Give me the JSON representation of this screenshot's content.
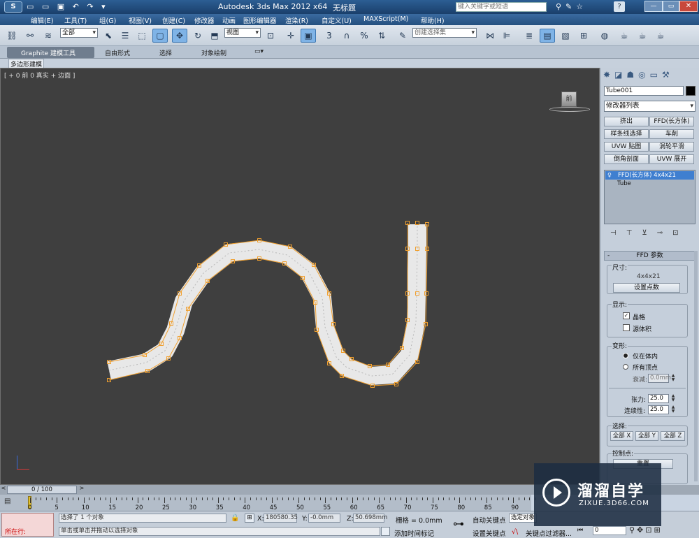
{
  "app": {
    "title": "Autodesk 3ds Max  2012 x64",
    "doc": "无标题",
    "search_placeholder": "键入关键字或短语"
  },
  "menu": [
    "编辑(E)",
    "工具(T)",
    "组(G)",
    "视图(V)",
    "创建(C)",
    "修改器",
    "动画",
    "图形编辑器",
    "渲染(R)",
    "自定义(U)",
    "MAXScript(M)",
    "帮助(H)"
  ],
  "toolbar": {
    "selection_filter": "全部",
    "ref_coord": "视图",
    "named_selection": "创建选择集",
    "snap_labels": [
      "3",
      "%",
      "n"
    ]
  },
  "ribbon": {
    "tabs": [
      "Graphite 建模工具",
      "自由形式",
      "选择",
      "对象绘制"
    ],
    "sub": "多边形建模"
  },
  "viewport": {
    "label": "[ + 0 前 0 真实 + 边面 ]",
    "viewcube_face": "前"
  },
  "panel": {
    "object_name": "Tube001",
    "modifier_list": "修改器列表",
    "mod_buttons": [
      "挤出",
      "FFD(长方体)",
      "样条线选择",
      "车削",
      "UVW 贴图",
      "涡轮平滑",
      "倒角剖面",
      "UVW 展开"
    ],
    "stack": [
      "FFD(长方体) 4x4x21",
      "Tube"
    ],
    "rollout_title": "FFD 参数",
    "dims_label": "尺寸:",
    "dims_value": "4x4x21",
    "set_points": "设置点数",
    "display_label": "显示:",
    "lattice": "晶格",
    "source_volume": "源体积",
    "deform_label": "变形:",
    "only_in_volume": "仅在体内",
    "all_vertices": "所有顶点",
    "falloff_label": "衰减:",
    "falloff_value": "0.0mm",
    "tension_label": "张力:",
    "tension_value": "25.0",
    "continuity_label": "连续性:",
    "continuity_value": "25.0",
    "select_label": "选择:",
    "all_x": "全部 X",
    "all_y": "全部 Y",
    "all_z": "全部 Z",
    "ctrl_label": "控制点:",
    "reset": "重置"
  },
  "timeline": {
    "frame": "0 / 100",
    "ticks": [
      "0",
      "5",
      "10",
      "15",
      "20",
      "25",
      "30",
      "35",
      "40",
      "45",
      "50",
      "55",
      "60",
      "65",
      "70",
      "75",
      "80",
      "85",
      "90"
    ]
  },
  "status": {
    "running": "所在行:",
    "selected": "选择了 1 个对象",
    "prompt": "单击或单击并拖动以选择对象",
    "x_label": "X:",
    "x_value": "180580.35",
    "y_label": "Y:",
    "y_value": "-0.0mm",
    "z_label": "Z:",
    "z_value": "50.698mm",
    "grid": "栅格 = 0.0mm",
    "add_time_tag": "添加时间标记",
    "auto_key": "自动关键点",
    "selected_obj": "选定对象",
    "set_key": "设置关键点",
    "key_filters": "关键点过滤器...",
    "frame_value": "0"
  },
  "watermark": {
    "cn": "溜溜自学",
    "url": "ZIXUE.3D66.COM"
  },
  "colors": {
    "viewport_bg": "#3f3f3f",
    "lattice": "#f0a030",
    "accent": "#3e78b3"
  }
}
